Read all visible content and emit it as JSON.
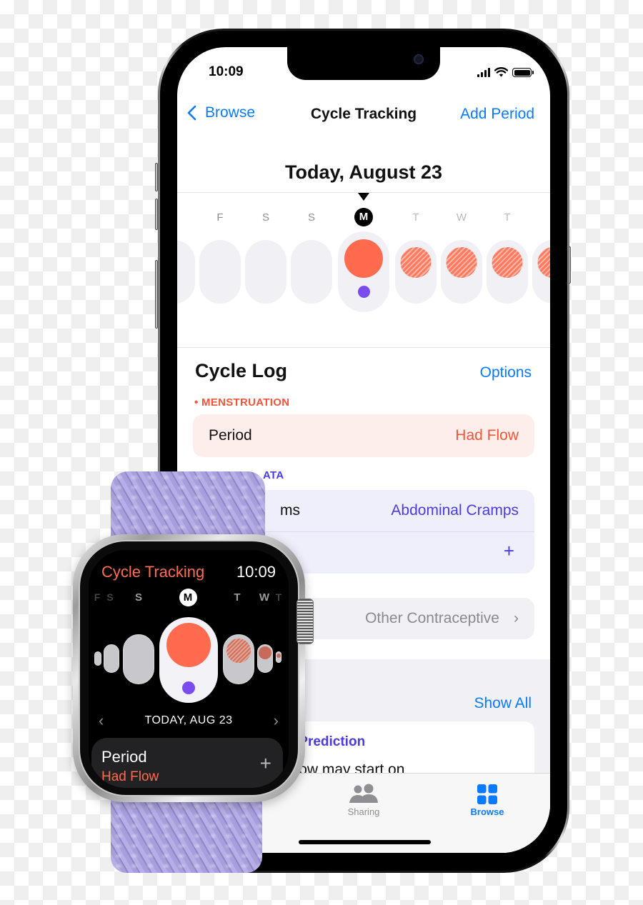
{
  "phone": {
    "status_bar": {
      "time": "10:09",
      "icons": [
        "cellular-signal-icon",
        "wifi-icon",
        "battery-icon"
      ]
    },
    "nav": {
      "back_label": "Browse",
      "title": "Cycle Tracking",
      "action_label": "Add Period"
    },
    "calendar": {
      "header": "Today, August 23",
      "days": [
        {
          "letter": "",
          "state": "past",
          "flow": "none"
        },
        {
          "letter": "F",
          "state": "past",
          "flow": "none"
        },
        {
          "letter": "S",
          "state": "past",
          "flow": "none"
        },
        {
          "letter": "S",
          "state": "past",
          "flow": "none"
        },
        {
          "letter": "M",
          "state": "today",
          "flow": "logged",
          "symptom": true
        },
        {
          "letter": "T",
          "state": "future",
          "flow": "predicted"
        },
        {
          "letter": "W",
          "state": "future",
          "flow": "predicted"
        },
        {
          "letter": "T",
          "state": "future",
          "flow": "predicted"
        },
        {
          "letter": "",
          "state": "future",
          "flow": "predicted"
        }
      ]
    },
    "cycle_log": {
      "title": "Cycle Log",
      "options_label": "Options",
      "menstruation_label": "• MENSTRUATION",
      "period_label": "Period",
      "period_value": "Had Flow",
      "other_data_label": "ATA",
      "symptoms_label": "ms",
      "symptoms_value": "Abdominal Cramps",
      "add_symptom": "+",
      "contraceptive_value": "Other Contraceptive",
      "contraceptive_chevron": "›"
    },
    "predictions": {
      "show_all_label": "Show All",
      "card_title": "dow Prediction",
      "card_body": "window may start on"
    },
    "tab_bar": {
      "tabs": [
        {
          "label": "Sharing",
          "icon": "sharing-people-icon",
          "active": false
        },
        {
          "label": "Browse",
          "icon": "browse-grid-icon",
          "active": true
        }
      ]
    }
  },
  "watch": {
    "title": "Cycle Tracking",
    "time": "10:09",
    "days": [
      "F",
      "S",
      "S",
      "M",
      "T",
      "W",
      "T"
    ],
    "today_letter": "M",
    "date_label": "TODAY, AUG 23",
    "prev": "‹",
    "next": "›",
    "card_label": "Period",
    "card_value": "Had Flow",
    "card_add": "+"
  },
  "colors": {
    "accent_blue": "#0a7aff",
    "period_red": "#ff6b4e",
    "symptom_purple": "#7a4cf0",
    "other_data_indigo": "#4a3ce0",
    "band_lavender": "#a49bd8"
  }
}
